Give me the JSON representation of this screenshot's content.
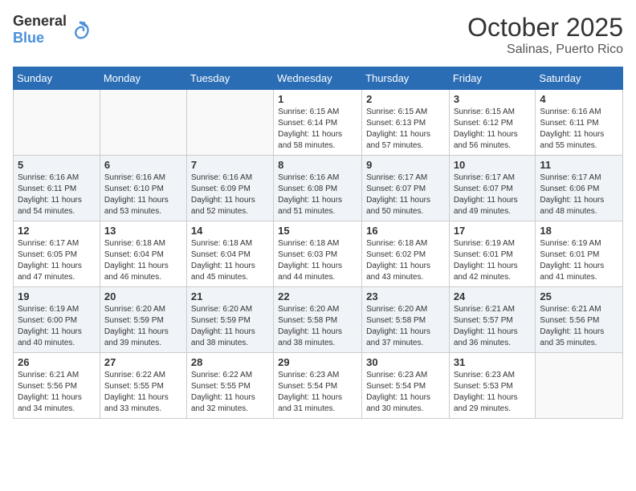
{
  "header": {
    "logo_general": "General",
    "logo_blue": "Blue",
    "title": "October 2025",
    "subtitle": "Salinas, Puerto Rico"
  },
  "days_of_week": [
    "Sunday",
    "Monday",
    "Tuesday",
    "Wednesday",
    "Thursday",
    "Friday",
    "Saturday"
  ],
  "weeks": [
    [
      {
        "day": "",
        "info": ""
      },
      {
        "day": "",
        "info": ""
      },
      {
        "day": "",
        "info": ""
      },
      {
        "day": "1",
        "info": "Sunrise: 6:15 AM\nSunset: 6:14 PM\nDaylight: 11 hours and 58 minutes."
      },
      {
        "day": "2",
        "info": "Sunrise: 6:15 AM\nSunset: 6:13 PM\nDaylight: 11 hours and 57 minutes."
      },
      {
        "day": "3",
        "info": "Sunrise: 6:15 AM\nSunset: 6:12 PM\nDaylight: 11 hours and 56 minutes."
      },
      {
        "day": "4",
        "info": "Sunrise: 6:16 AM\nSunset: 6:11 PM\nDaylight: 11 hours and 55 minutes."
      }
    ],
    [
      {
        "day": "5",
        "info": "Sunrise: 6:16 AM\nSunset: 6:11 PM\nDaylight: 11 hours and 54 minutes."
      },
      {
        "day": "6",
        "info": "Sunrise: 6:16 AM\nSunset: 6:10 PM\nDaylight: 11 hours and 53 minutes."
      },
      {
        "day": "7",
        "info": "Sunrise: 6:16 AM\nSunset: 6:09 PM\nDaylight: 11 hours and 52 minutes."
      },
      {
        "day": "8",
        "info": "Sunrise: 6:16 AM\nSunset: 6:08 PM\nDaylight: 11 hours and 51 minutes."
      },
      {
        "day": "9",
        "info": "Sunrise: 6:17 AM\nSunset: 6:07 PM\nDaylight: 11 hours and 50 minutes."
      },
      {
        "day": "10",
        "info": "Sunrise: 6:17 AM\nSunset: 6:07 PM\nDaylight: 11 hours and 49 minutes."
      },
      {
        "day": "11",
        "info": "Sunrise: 6:17 AM\nSunset: 6:06 PM\nDaylight: 11 hours and 48 minutes."
      }
    ],
    [
      {
        "day": "12",
        "info": "Sunrise: 6:17 AM\nSunset: 6:05 PM\nDaylight: 11 hours and 47 minutes."
      },
      {
        "day": "13",
        "info": "Sunrise: 6:18 AM\nSunset: 6:04 PM\nDaylight: 11 hours and 46 minutes."
      },
      {
        "day": "14",
        "info": "Sunrise: 6:18 AM\nSunset: 6:04 PM\nDaylight: 11 hours and 45 minutes."
      },
      {
        "day": "15",
        "info": "Sunrise: 6:18 AM\nSunset: 6:03 PM\nDaylight: 11 hours and 44 minutes."
      },
      {
        "day": "16",
        "info": "Sunrise: 6:18 AM\nSunset: 6:02 PM\nDaylight: 11 hours and 43 minutes."
      },
      {
        "day": "17",
        "info": "Sunrise: 6:19 AM\nSunset: 6:01 PM\nDaylight: 11 hours and 42 minutes."
      },
      {
        "day": "18",
        "info": "Sunrise: 6:19 AM\nSunset: 6:01 PM\nDaylight: 11 hours and 41 minutes."
      }
    ],
    [
      {
        "day": "19",
        "info": "Sunrise: 6:19 AM\nSunset: 6:00 PM\nDaylight: 11 hours and 40 minutes."
      },
      {
        "day": "20",
        "info": "Sunrise: 6:20 AM\nSunset: 5:59 PM\nDaylight: 11 hours and 39 minutes."
      },
      {
        "day": "21",
        "info": "Sunrise: 6:20 AM\nSunset: 5:59 PM\nDaylight: 11 hours and 38 minutes."
      },
      {
        "day": "22",
        "info": "Sunrise: 6:20 AM\nSunset: 5:58 PM\nDaylight: 11 hours and 38 minutes."
      },
      {
        "day": "23",
        "info": "Sunrise: 6:20 AM\nSunset: 5:58 PM\nDaylight: 11 hours and 37 minutes."
      },
      {
        "day": "24",
        "info": "Sunrise: 6:21 AM\nSunset: 5:57 PM\nDaylight: 11 hours and 36 minutes."
      },
      {
        "day": "25",
        "info": "Sunrise: 6:21 AM\nSunset: 5:56 PM\nDaylight: 11 hours and 35 minutes."
      }
    ],
    [
      {
        "day": "26",
        "info": "Sunrise: 6:21 AM\nSunset: 5:56 PM\nDaylight: 11 hours and 34 minutes."
      },
      {
        "day": "27",
        "info": "Sunrise: 6:22 AM\nSunset: 5:55 PM\nDaylight: 11 hours and 33 minutes."
      },
      {
        "day": "28",
        "info": "Sunrise: 6:22 AM\nSunset: 5:55 PM\nDaylight: 11 hours and 32 minutes."
      },
      {
        "day": "29",
        "info": "Sunrise: 6:23 AM\nSunset: 5:54 PM\nDaylight: 11 hours and 31 minutes."
      },
      {
        "day": "30",
        "info": "Sunrise: 6:23 AM\nSunset: 5:54 PM\nDaylight: 11 hours and 30 minutes."
      },
      {
        "day": "31",
        "info": "Sunrise: 6:23 AM\nSunset: 5:53 PM\nDaylight: 11 hours and 29 minutes."
      },
      {
        "day": "",
        "info": ""
      }
    ]
  ]
}
